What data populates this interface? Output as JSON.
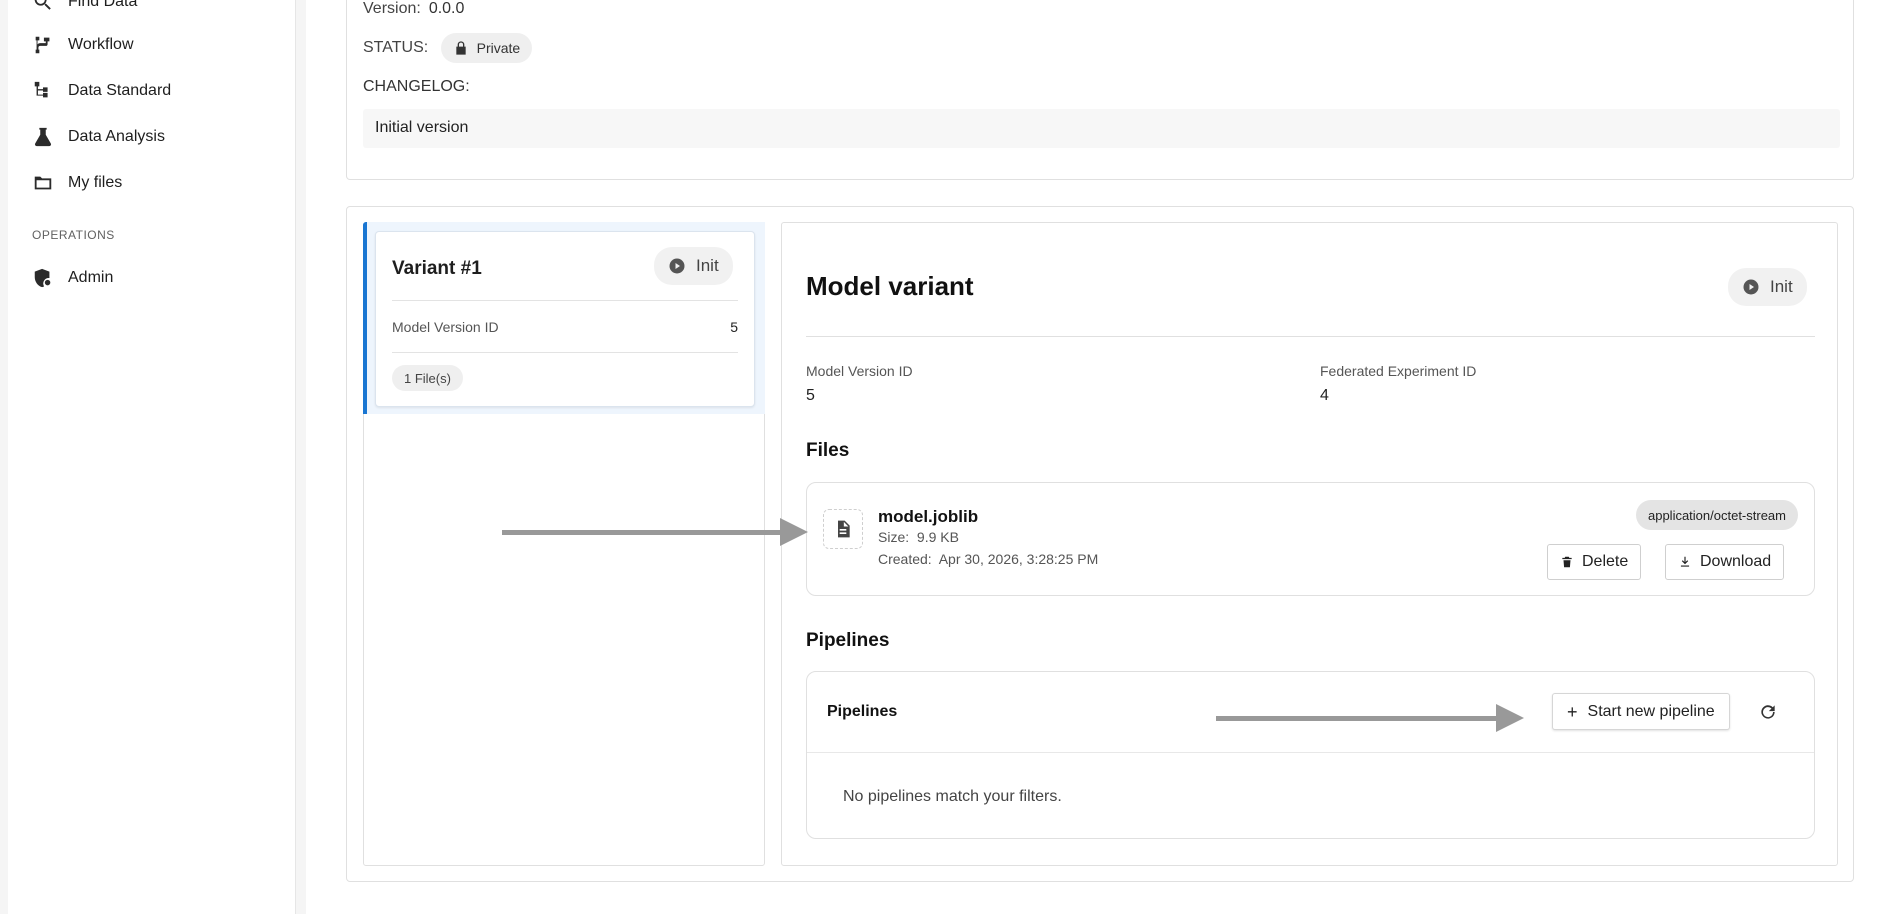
{
  "sidebar": {
    "items": [
      {
        "label": "Find Data",
        "icon": "search-icon"
      },
      {
        "label": "Workflow",
        "icon": "workflow-icon"
      },
      {
        "label": "Data Standard",
        "icon": "hierarchy-icon"
      },
      {
        "label": "Data Analysis",
        "icon": "flask-icon"
      },
      {
        "label": "My files",
        "icon": "folder-icon"
      }
    ],
    "section_operations": "OPERATIONS",
    "admin": {
      "label": "Admin",
      "icon": "admin-shield-icon"
    }
  },
  "model": {
    "version_label": "Version:",
    "version_value": "0.0.0",
    "status_label": "STATUS:",
    "status_value": "Private",
    "changelog_label": "CHANGELOG:",
    "changelog_value": "Initial version"
  },
  "variant_card": {
    "title": "Variant #1",
    "status": "Init",
    "model_version_label": "Model Version ID",
    "model_version_value": "5",
    "files_chip": "1 File(s)"
  },
  "detail": {
    "title": "Model variant",
    "status": "Init",
    "model_version_label": "Model Version ID",
    "model_version_value": "5",
    "fed_exp_label": "Federated Experiment ID",
    "fed_exp_value": "4",
    "files_title": "Files",
    "file": {
      "name": "model.joblib",
      "size_label": "Size:",
      "size_value": "9.9 KB",
      "created_label": "Created:",
      "created_value": "Apr 30, 2026, 3:28:25 PM",
      "mime": "application/octet-stream",
      "delete_label": "Delete",
      "download_label": "Download"
    },
    "pipelines_title": "Pipelines",
    "pipelines": {
      "header": "Pipelines",
      "start_label": "Start new pipeline",
      "empty": "No pipelines match your filters."
    }
  },
  "colors": {
    "accent": "#1976d2",
    "arrow": "#999999"
  }
}
